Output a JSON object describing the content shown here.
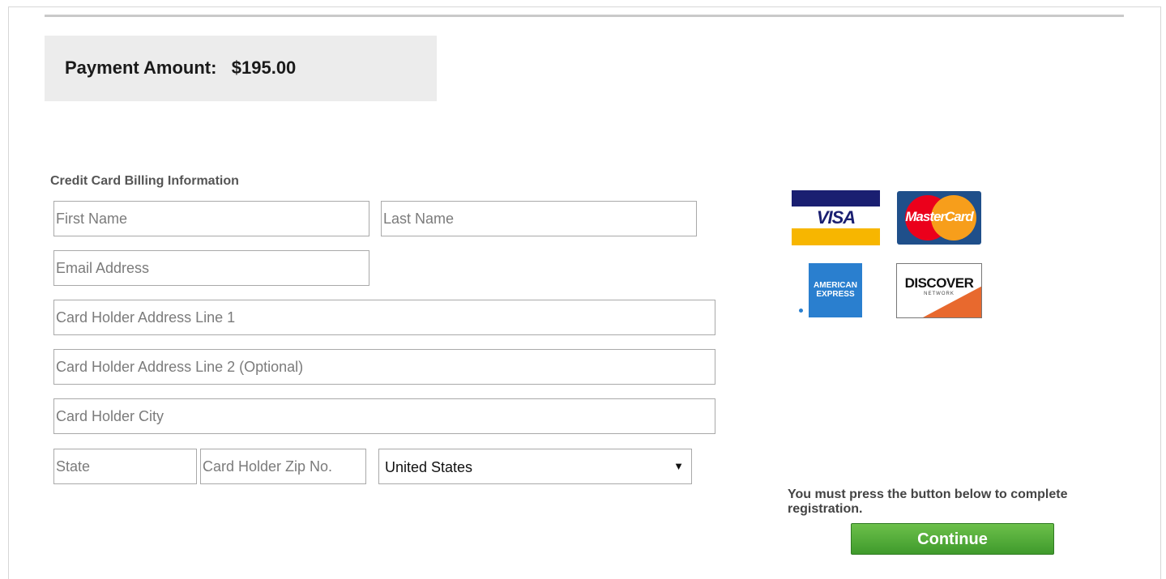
{
  "payment": {
    "label": "Payment Amount:",
    "amount": "$195.00"
  },
  "billing": {
    "title": "Credit Card Billing Information",
    "fields": {
      "first_name": {
        "value": "",
        "placeholder": "First Name"
      },
      "last_name": {
        "value": "",
        "placeholder": "Last Name"
      },
      "email": {
        "value": "",
        "placeholder": "Email Address"
      },
      "address1": {
        "value": "",
        "placeholder": "Card Holder Address Line 1"
      },
      "address2": {
        "value": "",
        "placeholder": "Card Holder Address Line 2 (Optional)"
      },
      "city": {
        "value": "",
        "placeholder": "Card Holder City"
      },
      "state": {
        "value": "",
        "placeholder": "State"
      },
      "zip": {
        "value": "",
        "placeholder": "Card Holder Zip No."
      }
    },
    "country": {
      "selected": "United States"
    }
  },
  "cards": {
    "visa": {
      "text": "VISA",
      "icon": "visa-logo-icon"
    },
    "mastercard": {
      "text": "MasterCard",
      "icon": "mastercard-logo-icon"
    },
    "amex": {
      "text_line1": "AMERICAN",
      "text_line2": "EXPRESS",
      "icon": "amex-logo-icon"
    },
    "discover": {
      "text": "DISCOVER",
      "sub": "NETWORK",
      "icon": "discover-logo-icon"
    }
  },
  "notice": "You must press the button below to complete registration.",
  "continue_label": "Continue",
  "colors": {
    "button_green": "#4caf35",
    "amount_box": "#ececec"
  }
}
